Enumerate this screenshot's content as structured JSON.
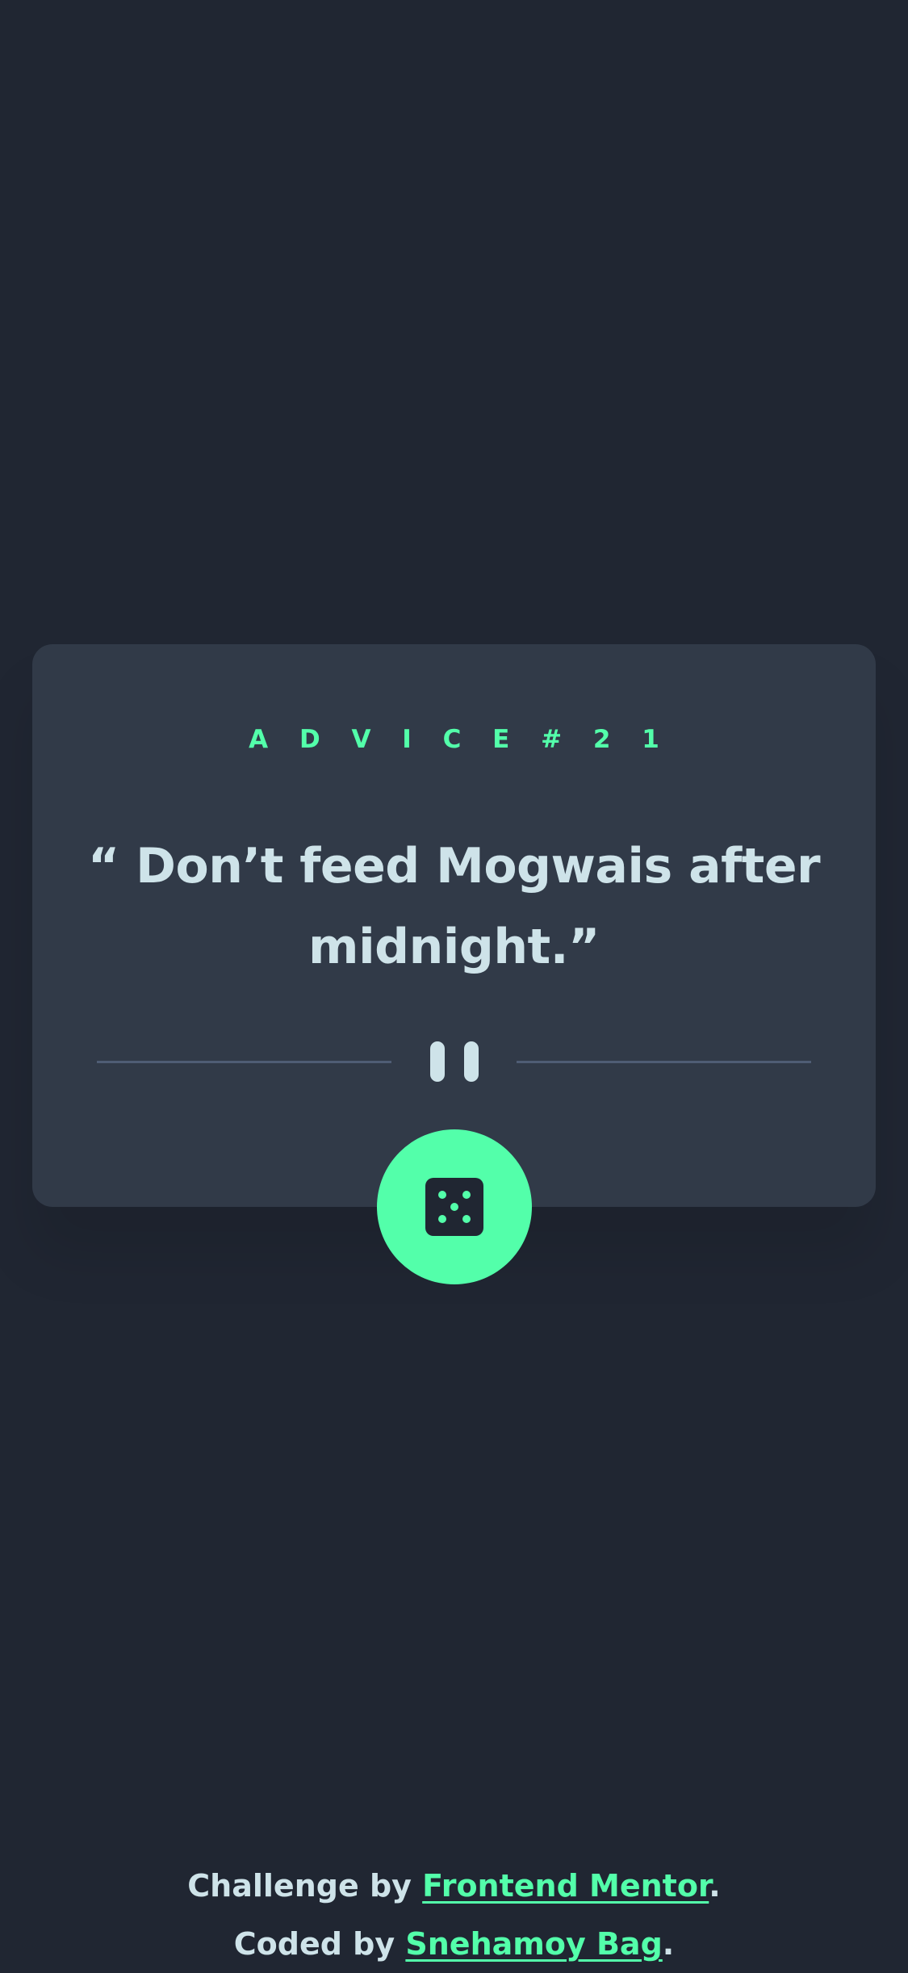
{
  "advice": {
    "id_label": "A D V I C E   # 2 1",
    "quote": "“ Don’t feed Mogwais after midnight.”"
  },
  "button": {
    "icon": "dice-icon"
  },
  "footer": {
    "challenge_prefix": "Challenge by ",
    "challenge_link": "Frontend Mentor",
    "challenge_suffix": ".",
    "coded_prefix": "Coded by ",
    "coded_link": "Snehamoy Bag",
    "coded_suffix": "."
  },
  "colors": {
    "background": "#202632",
    "card": "#313a48",
    "accent": "#53ffaa",
    "text": "#cee3e9",
    "divider": "#4f5d74"
  }
}
